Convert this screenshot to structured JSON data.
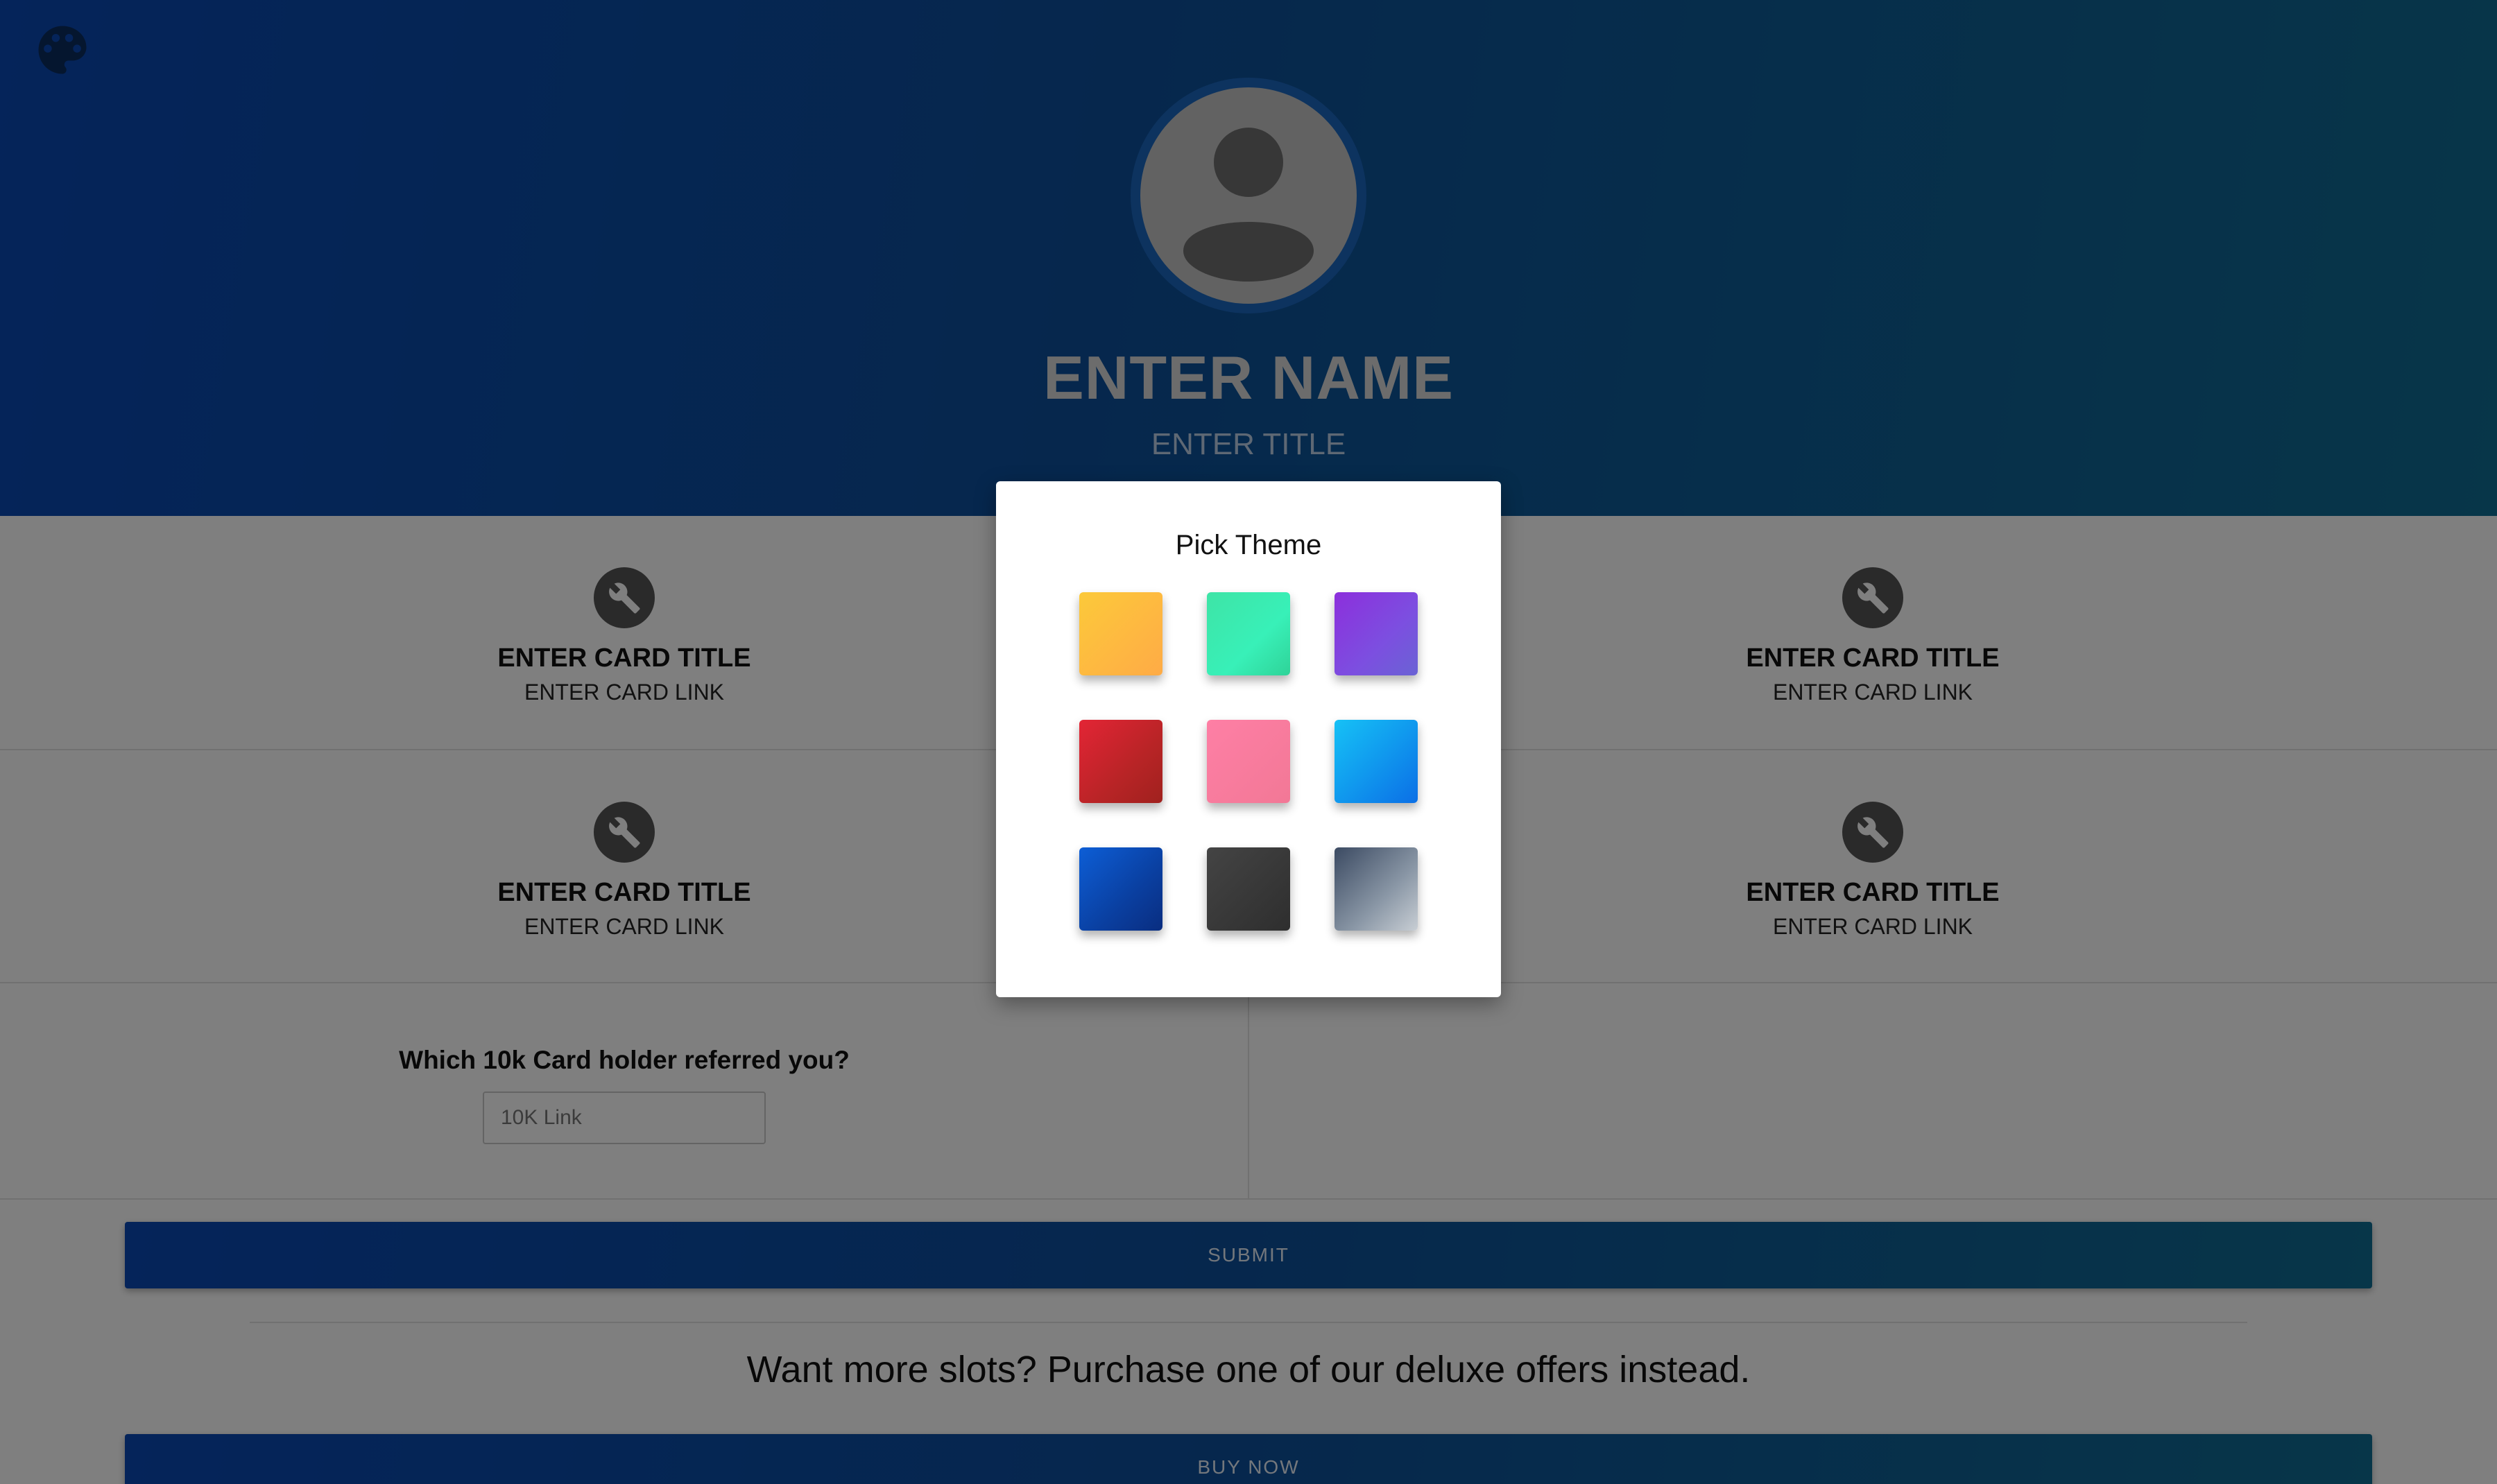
{
  "hero": {
    "name": "ENTER NAME",
    "title": "ENTER TITLE"
  },
  "cards": [
    {
      "title": "ENTER CARD TITLE",
      "link": "ENTER CARD LINK"
    },
    {
      "title": "ENTER CARD TITLE",
      "link": "ENTER CARD LINK"
    },
    {
      "title": "ENTER CARD TITLE",
      "link": "ENTER CARD LINK"
    },
    {
      "title": "ENTER CARD TITLE",
      "link": "ENTER CARD LINK"
    }
  ],
  "referral": {
    "label": "Which 10k Card holder referred you?",
    "placeholder": "10K Link",
    "value": ""
  },
  "submit_label": "SUBMIT",
  "upsell_text": "Want more slots? Purchase one of our deluxe offers instead.",
  "buy_label": "BUY NOW",
  "theme_modal": {
    "title": "Pick Theme",
    "swatch_colors": [
      "#fcc93a",
      "#38f0b8",
      "#8c2fdc",
      "#e32535",
      "#fe7fa5",
      "#16c1f6",
      "#0d5ed6",
      "#333333",
      "#8a97a6"
    ]
  },
  "colors": {
    "hero_gradient_start": "#0a48b4",
    "hero_gradient_end": "#0f6c92",
    "overlay": "rgba(0,0,0,0.5)"
  }
}
